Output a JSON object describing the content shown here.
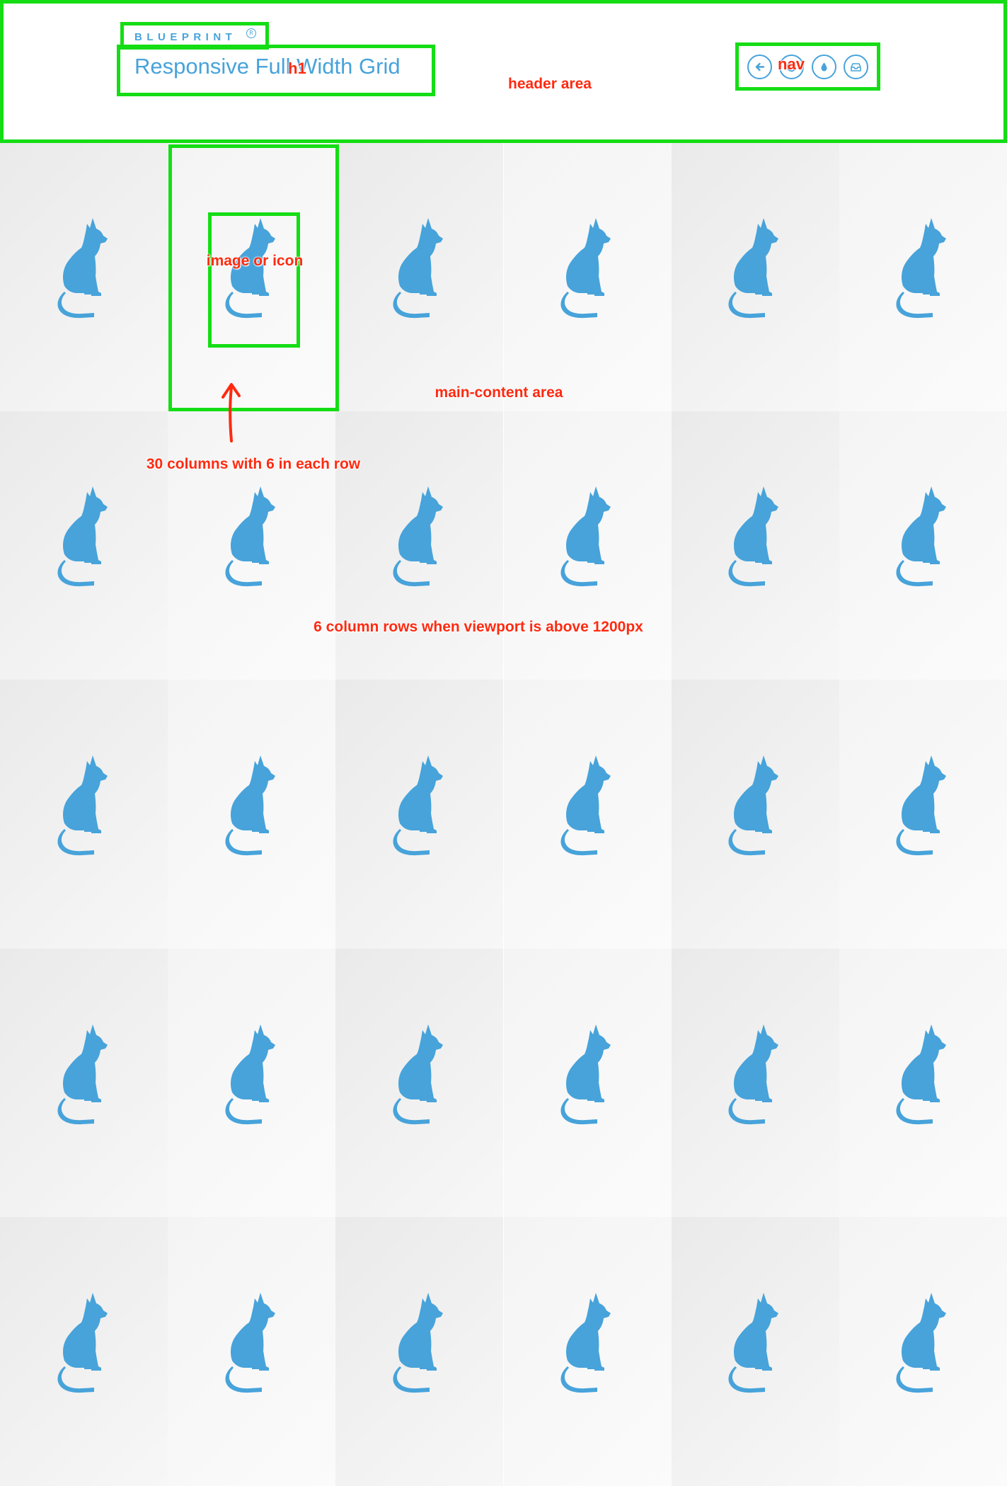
{
  "header": {
    "logo": "BLUEPRINT",
    "logo_mark": "R",
    "title": "Responsive Full Width Grid",
    "nav": [
      {
        "icon": "arrow-left-icon"
      },
      {
        "icon": "refresh-icon"
      },
      {
        "icon": "droplet-icon"
      },
      {
        "icon": "inbox-icon"
      }
    ]
  },
  "grid": {
    "columns_per_row": 6,
    "rows": 5,
    "item_icon": "cat-icon"
  },
  "annotations": {
    "h1": "h1",
    "nav": "nav",
    "header_area": "header area",
    "image_or_icon": "image or icon",
    "main_content_area": "main-content area",
    "columns": "30 columns with 6 in each row",
    "viewport": "6 column rows when viewport is above 1200px"
  },
  "colors": {
    "accent": "#47a3da",
    "annotation_box": "#15dd15",
    "annotation_text": "#ff2a10"
  }
}
